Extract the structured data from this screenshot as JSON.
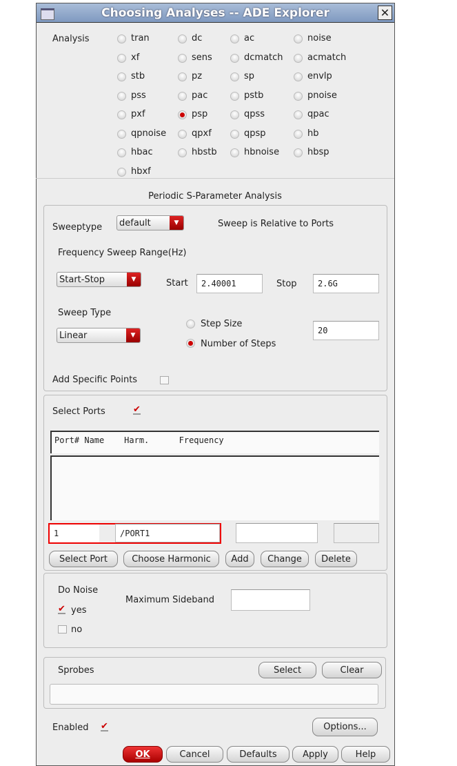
{
  "window": {
    "title": "Choosing Analyses -- ADE Explorer"
  },
  "analysis": {
    "label": "Analysis",
    "selected": "psp",
    "options": [
      "tran",
      "dc",
      "ac",
      "noise",
      "xf",
      "sens",
      "dcmatch",
      "acmatch",
      "stb",
      "pz",
      "sp",
      "envlp",
      "pss",
      "pac",
      "pstb",
      "pnoise",
      "pxf",
      "psp",
      "qpss",
      "qpac",
      "qpnoise",
      "qpxf",
      "qpsp",
      "hb",
      "hbac",
      "hbstb",
      "hbnoise",
      "hbsp",
      "hbxf"
    ]
  },
  "section_title": "Periodic S-Parameter Analysis",
  "sweep": {
    "sweeptype_label": "Sweeptype",
    "sweeptype_value": "default",
    "relative_note": "Sweep is Relative to Ports",
    "range_label": "Frequency Sweep Range(Hz)",
    "range_mode": "Start-Stop",
    "start_label": "Start",
    "start_value": "2.40001",
    "stop_label": "Stop",
    "stop_value": "2.6G",
    "sweep_type_label": "Sweep Type",
    "sweep_type_value": "Linear",
    "step_size_label": "Step Size",
    "num_steps_label": "Number of Steps",
    "steps_value": "20",
    "specific_points_label": "Add Specific Points"
  },
  "ports": {
    "label": "Select Ports",
    "header": "Port# Name    Harm.      Frequency",
    "port_num": "1",
    "port_name": "/PORT1",
    "buttons": [
      "Select Port",
      "Choose Harmonic",
      "Add",
      "Change",
      "Delete"
    ]
  },
  "noise": {
    "label": "Do Noise",
    "yes": "yes",
    "no": "no",
    "max_sideband_label": "Maximum Sideband"
  },
  "sprobes": {
    "label": "Sprobes",
    "select": "Select",
    "clear": "Clear"
  },
  "enabled_label": "Enabled",
  "options_button": "Options...",
  "footer": {
    "ok": "OK",
    "cancel": "Cancel",
    "defaults": "Defaults",
    "apply": "Apply",
    "help": "Help"
  }
}
